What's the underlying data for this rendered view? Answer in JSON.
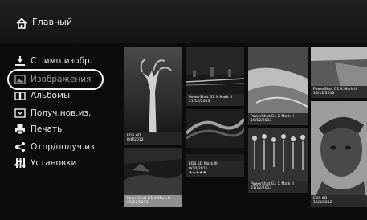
{
  "header": {
    "title": "Главный",
    "icon": "home-icon"
  },
  "menu": {
    "items": [
      {
        "label": "Ст.имп.изобр.",
        "icon": "import-icon"
      },
      {
        "label": "Изображения",
        "icon": "images-icon",
        "selected": true
      },
      {
        "label": "Альбомы",
        "icon": "albums-icon"
      },
      {
        "label": "Получ.нов.из.",
        "icon": "new-images-icon"
      },
      {
        "label": "Печать",
        "icon": "printer-icon"
      },
      {
        "label": "Отпр/получ.из",
        "icon": "share-icon"
      },
      {
        "label": "Установки",
        "icon": "settings-icon"
      }
    ]
  },
  "photos": [
    {
      "line1": "EOS 6D",
      "line2": "8/8/2012",
      "line3": ""
    },
    {
      "line1": "PowerShot G1 X Mark II",
      "line2": "21/12/2013",
      "line3": ""
    },
    {
      "line1": "EOS 5D Mark III",
      "line2": "9/10/2011",
      "line3": "★★★★★"
    },
    {
      "line1": "PowerShot G1 X Mark II",
      "line2": "21/12/2013",
      "line3": ""
    },
    {
      "line1": "PowerShot G1 X Mark II",
      "line2": "19/12/2013",
      "line3": ""
    },
    {
      "line1": "PowerShot G1 X Mark II",
      "line2": "21/12/2013",
      "line3": ""
    },
    {
      "line1": "PowerShot G1 X Mark II",
      "line2": "18/12/2013",
      "line3": ""
    },
    {
      "line1": "EOS 6D",
      "line2": "13/8/2012",
      "line3": ""
    }
  ]
}
